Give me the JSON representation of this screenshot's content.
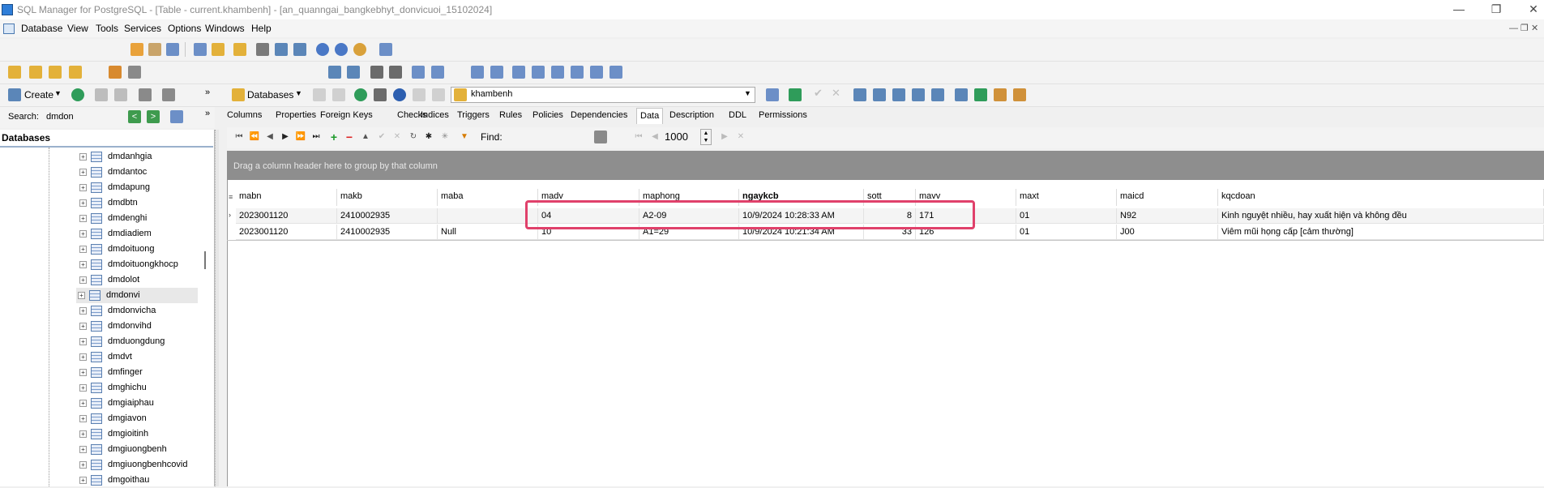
{
  "window": {
    "title": "SQL Manager for PostgreSQL - [Table - current.khambenh] - [an_quanngai_bangkebhyt_donvicuoi_15102024]",
    "minimize": "—",
    "maximize": "❐",
    "close": "✕"
  },
  "menu": [
    "Database",
    "View",
    "Tools",
    "Services",
    "Options",
    "Windows",
    "Help"
  ],
  "left_toolbar": {
    "create_label": "Create",
    "search_label": "Search:",
    "search_value": "dmdon"
  },
  "object_toolbar": {
    "databases_label": "Databases",
    "table_selector_value": "khambenh"
  },
  "db_tree": {
    "header": "Databases",
    "items": [
      "dmdanhgia",
      "dmdantoc",
      "dmdapung",
      "dmdbtn",
      "dmdenghi",
      "dmdiadiem",
      "dmdoituong",
      "dmdoituongkhocp",
      "dmdolot",
      "dmdonvi",
      "dmdonvicha",
      "dmdonvihd",
      "dmduongdung",
      "dmdvt",
      "dmfinger",
      "dmghichu",
      "dmgiaiphau",
      "dmgiavon",
      "dmgioitinh",
      "dmgiuongbenh",
      "dmgiuongbenhcovid",
      "dmgoithau"
    ],
    "selected": "dmdonvi"
  },
  "tabs": [
    "Columns",
    "Properties",
    "Foreign Keys",
    "Checks",
    "Indices",
    "Triggers",
    "Rules",
    "Policies",
    "Dependencies",
    "Data",
    "Description",
    "DDL",
    "Permissions"
  ],
  "active_tab": "Data",
  "data_nav": {
    "find_label": "Find:",
    "limit_value": "1000"
  },
  "grid": {
    "group_hint": "Drag a column header here to group by that column",
    "columns": [
      "mabn",
      "makb",
      "maba",
      "madv",
      "maphong",
      "ngaykcb",
      "sott",
      "mavv",
      "maxt",
      "maicd",
      "kqcdoan"
    ],
    "rows": [
      [
        "2023001120",
        "2410002935",
        "",
        "04",
        "A2-09",
        "10/9/2024 10:28:33 AM",
        "8",
        "171",
        "01",
        "N92",
        "Kinh nguyệt nhiều, hay xuất hiện và không đều"
      ],
      [
        "2023001120",
        "2410002935",
        "Null",
        "10",
        "A1=29",
        "10/9/2024 10:21:34 AM",
        "33",
        "126",
        "01",
        "J00",
        "Viêm mũi họng cấp [cảm thường]"
      ]
    ]
  }
}
